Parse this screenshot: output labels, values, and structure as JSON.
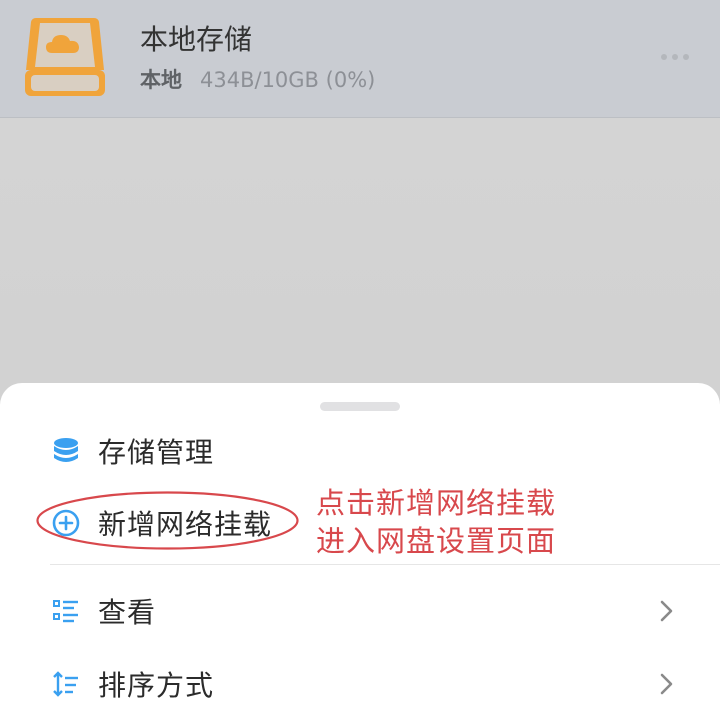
{
  "storage": {
    "name": "本地存储",
    "type_label": "本地",
    "usage": "434B/10GB (0%)",
    "icon": "cloud-drive-icon",
    "accent_color": "#f0a43b"
  },
  "sheet": {
    "items": [
      {
        "label": "存储管理",
        "icon": "database-icon"
      },
      {
        "label": "新增网络挂载",
        "icon": "plus-circle-icon"
      },
      {
        "label": "查看",
        "icon": "list-view-icon",
        "has_chevron": true
      },
      {
        "label": "排序方式",
        "icon": "sort-icon",
        "has_chevron": true
      }
    ],
    "icon_color": "#3aa0f0"
  },
  "annotation": {
    "line1": "点击新增网络挂载",
    "line2": "进入网盘设置页面",
    "color": "#d8484c"
  }
}
